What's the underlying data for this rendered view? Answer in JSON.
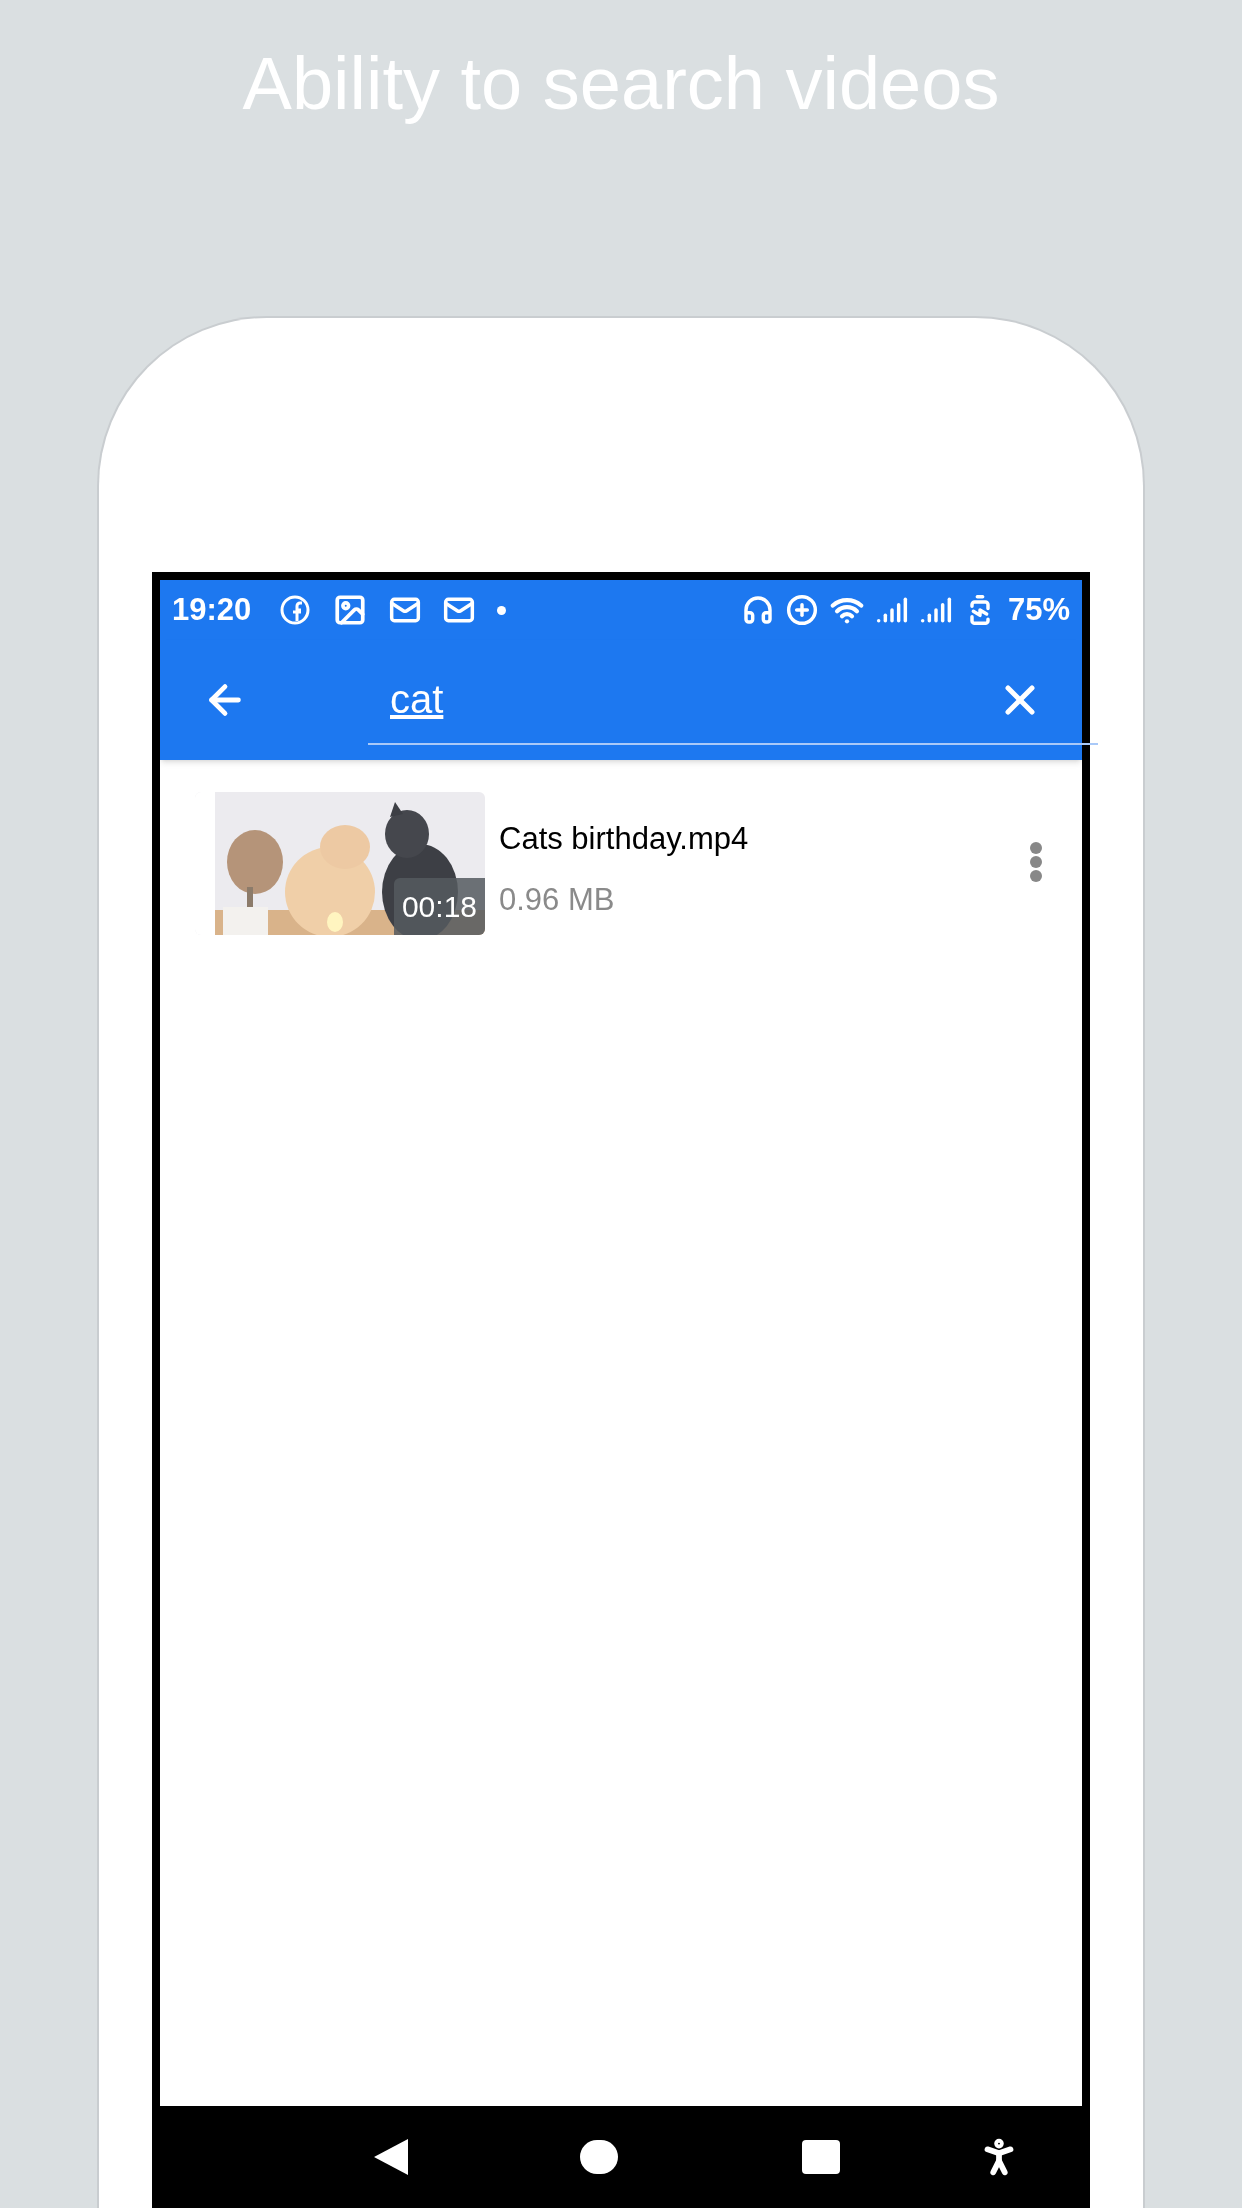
{
  "headline": "Ability to search videos",
  "status_bar": {
    "time": "19:20",
    "battery": "75%"
  },
  "search": {
    "value": "cat"
  },
  "results": [
    {
      "title": "Cats birthday.mp4",
      "size": "0.96 MB",
      "duration": "00:18"
    }
  ]
}
